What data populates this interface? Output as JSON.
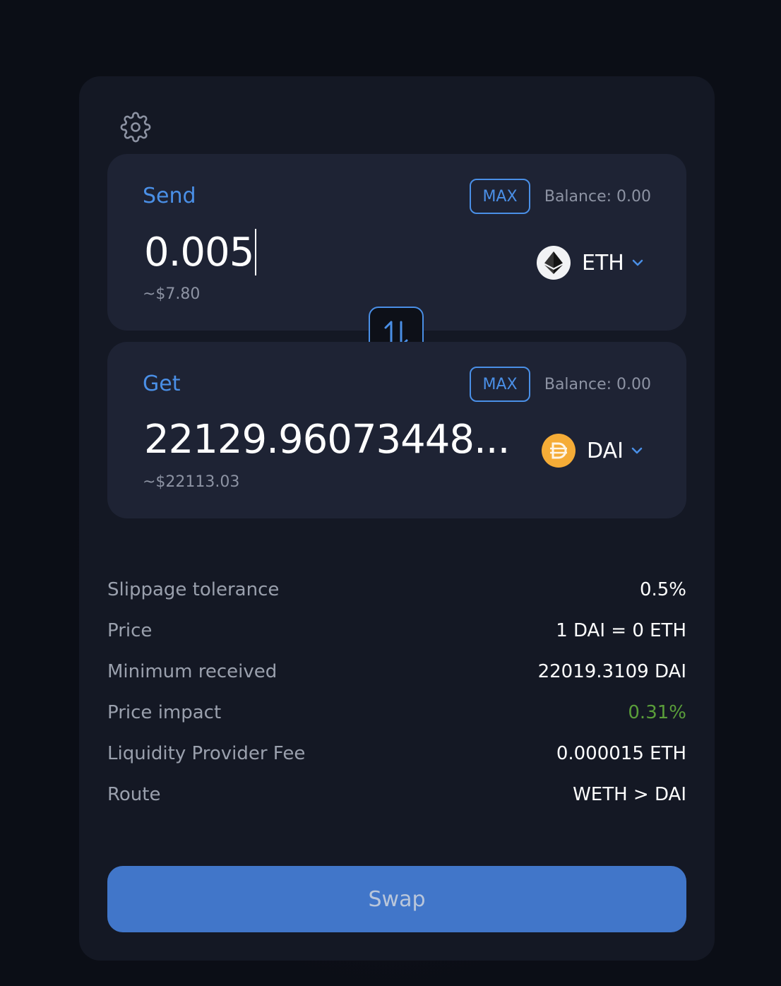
{
  "send": {
    "label": "Send",
    "max_label": "MAX",
    "balance": "Balance: 0.00",
    "amount": "0.005",
    "usd": "~$7.80",
    "token": {
      "symbol": "ETH",
      "icon": "eth-icon"
    }
  },
  "get": {
    "label": "Get",
    "max_label": "MAX",
    "balance": "Balance: 0.00",
    "amount": "22129.96073448...",
    "usd": "~$22113.03",
    "token": {
      "symbol": "DAI",
      "icon": "dai-icon"
    }
  },
  "details": [
    {
      "key": "Slippage tolerance",
      "value": "0.5%"
    },
    {
      "key": "Price",
      "value": "1 DAI = 0 ETH"
    },
    {
      "key": "Minimum received",
      "value": "22019.3109 DAI"
    },
    {
      "key": "Price impact",
      "value": "0.31%"
    },
    {
      "key": "Liquidity Provider Fee",
      "value": "0.000015 ETH"
    },
    {
      "key": "Route",
      "value": "WETH > DAI"
    }
  ],
  "swap_button": "Swap",
  "colors": {
    "accent": "#4a8fe6",
    "positive": "#5a9e3a",
    "button": "#4176c9"
  }
}
